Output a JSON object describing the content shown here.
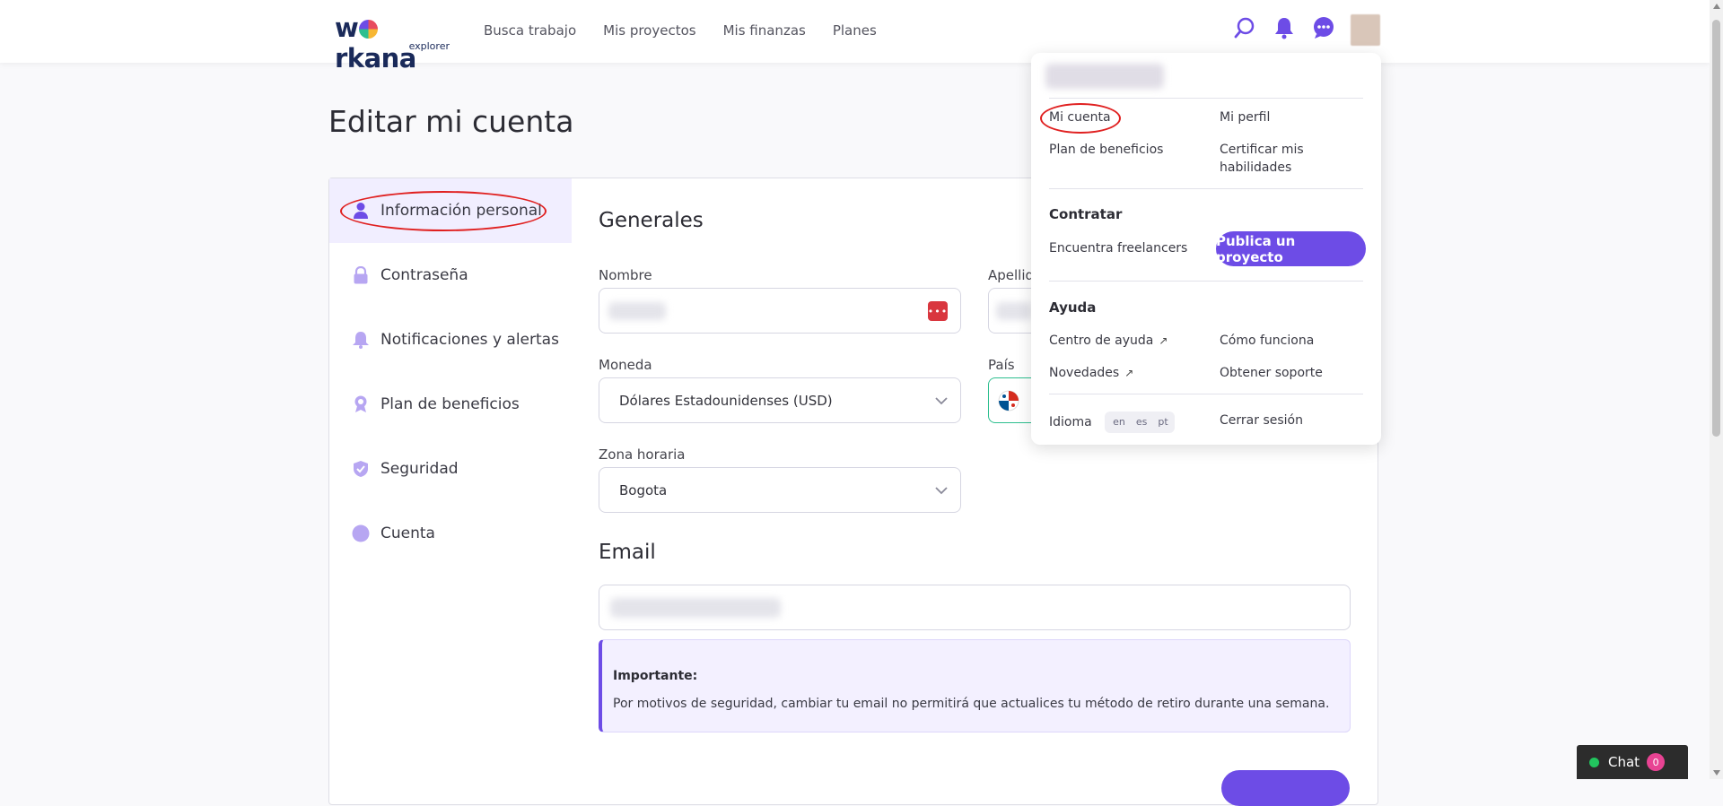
{
  "brand": {
    "name_pre": "w",
    "name_post": "rkana",
    "sub": "explorer"
  },
  "nav": {
    "items": [
      "Busca trabajo",
      "Mis proyectos",
      "Mis finanzas",
      "Planes"
    ]
  },
  "page": {
    "title": "Editar mi cuenta"
  },
  "sidebar": {
    "items": [
      {
        "label": "Información personal"
      },
      {
        "label": "Contraseña"
      },
      {
        "label": "Notificaciones y alertas"
      },
      {
        "label": "Plan de beneficios"
      },
      {
        "label": "Seguridad"
      },
      {
        "label": "Cuenta"
      }
    ]
  },
  "general": {
    "title": "Generales",
    "nombre_label": "Nombre",
    "apellido_label": "Apellido",
    "moneda_label": "Moneda",
    "moneda_value": "Dólares Estadounidenses (USD)",
    "pais_label": "País",
    "zona_label": "Zona horaria",
    "zona_value": "Bogota"
  },
  "email": {
    "title": "Email",
    "notice_title": "Importante:",
    "notice_text": "Por motivos de seguridad, cambiar tu email no permitirá que actualices tu método de retiro durante una semana."
  },
  "menu": {
    "mi_cuenta": "Mi cuenta",
    "mi_perfil": "Mi perfil",
    "plan_beneficios": "Plan de beneficios",
    "certificar": "Certificar mis habilidades",
    "contratar_head": "Contratar",
    "encuentra": "Encuentra freelancers",
    "publica": "Publica un proyecto",
    "ayuda_head": "Ayuda",
    "centro_ayuda": "Centro de ayuda",
    "como_funciona": "Cómo funciona",
    "novedades": "Novedades",
    "obtener_soporte": "Obtener soporte",
    "idioma": "Idioma",
    "lang_en": "en",
    "lang_es": "es",
    "lang_pt": "pt",
    "cerrar_sesion": "Cerrar sesión"
  },
  "chat": {
    "label": "Chat",
    "count": "0"
  },
  "colors": {
    "accent": "#6d4ce6",
    "highlight": "#e02020"
  }
}
